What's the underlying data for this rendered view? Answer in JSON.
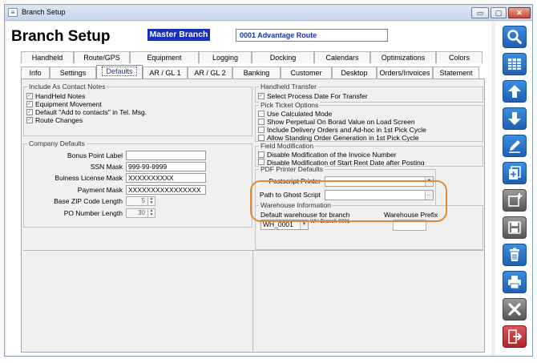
{
  "window": {
    "title": "Branch Setup",
    "controls": {
      "minimize": "▭",
      "maximize": "▢",
      "close": "✕"
    }
  },
  "header": {
    "title": "Branch Setup",
    "branch_badge": "Master Branch",
    "route": "0001  Advantage Route"
  },
  "tabs_row1": [
    "Handheld",
    "Route/GPS",
    "Equipment",
    "Logging",
    "Docking",
    "Calendars",
    "Optimizations",
    "Colors"
  ],
  "tabs_row2": [
    "Info",
    "Settings",
    "Defaults",
    "AR / GL 1",
    "AR / GL 2",
    "Banking",
    "Customer",
    "Desktop",
    "Orders/Invoices",
    "Statement"
  ],
  "active_tab": "Defaults",
  "contact_notes": {
    "label": "Include As Contact Notes",
    "items": [
      {
        "label": "HandHeld Notes",
        "checked": true
      },
      {
        "label": "Equipment Movement",
        "checked": true
      },
      {
        "label": "Default \"Add to contacts\" in Tel. Msg.",
        "checked": true
      },
      {
        "label": "Route Changes",
        "checked": true
      }
    ]
  },
  "company_defaults": {
    "label": "Company Defaults",
    "bonus_point_label": {
      "label": "Bonus Point Label",
      "value": ""
    },
    "ssn_mask": {
      "label": "SSN Mask",
      "value": "999-99-9999"
    },
    "business_license_mask": {
      "label": "Buiness License Mask",
      "value": "XXXXXXXXXX"
    },
    "payment_mask": {
      "label": "Payment Mask",
      "value": "XXXXXXXXXXXXXXXX"
    },
    "base_zip_length": {
      "label": "Base ZIP Code Length",
      "value": "5"
    },
    "po_number_length": {
      "label": "PO Number Length",
      "value": "30"
    }
  },
  "handheld_transfer": {
    "label": "Handheld Transfer",
    "items": [
      {
        "label": "Select Process Date For Transfer",
        "checked": true
      }
    ]
  },
  "pick_ticket": {
    "label": "Pick Ticket Options",
    "items": [
      {
        "label": "Use Calculated Mode",
        "checked": false
      },
      {
        "label": "Show Perpetual On Borad Value on Load Screen",
        "checked": false
      },
      {
        "label": "Include Delivery Orders and Ad-hoc in 1st Pick Cycle",
        "checked": false
      },
      {
        "label": "Allow Standing Order Generation in 1st Pick Cycle",
        "checked": false
      }
    ]
  },
  "field_modification": {
    "label": "Field Modification",
    "items": [
      {
        "label": "Disable Modification of the Invoice Number",
        "checked": false
      },
      {
        "label": "Disable Modification of Start Rent Date after Posting",
        "checked": false
      }
    ]
  },
  "pdf_printer": {
    "label": "PDF Printer Defaults",
    "postscript_printer": {
      "label": "Postscript Printer",
      "value": ""
    },
    "ghost_script_path": {
      "label": "Path to Ghost Script",
      "value": ""
    }
  },
  "warehouse": {
    "label": "Warehouse Information",
    "default_label": "Default warehouse for branch",
    "default_value": "WH_0001",
    "default_desc": "WH Branch 0001",
    "prefix_label": "Warehouse Prefix",
    "prefix_value": ""
  },
  "sidebar_buttons": [
    {
      "name": "search-icon",
      "color": "#2b78cf"
    },
    {
      "name": "table-grid-icon",
      "color": "#2b78cf"
    },
    {
      "name": "arrow-up-icon",
      "color": "#2b78cf"
    },
    {
      "name": "arrow-down-icon",
      "color": "#2b78cf"
    },
    {
      "name": "edit-pencil-icon",
      "color": "#2b78cf"
    },
    {
      "name": "add-copy-icon",
      "color": "#2b78cf"
    },
    {
      "name": "new-record-icon",
      "color": "#777777"
    },
    {
      "name": "save-disk-icon",
      "color": "#777777"
    },
    {
      "name": "trash-icon",
      "color": "#2b78cf"
    },
    {
      "name": "print-icon",
      "color": "#2b78cf"
    },
    {
      "name": "cancel-x-icon",
      "color": "#777777"
    },
    {
      "name": "exit-door-icon",
      "color": "#c5303a"
    }
  ],
  "colors": {
    "accent": "#1a2fb8",
    "highlight_ring": "#e58a33"
  }
}
